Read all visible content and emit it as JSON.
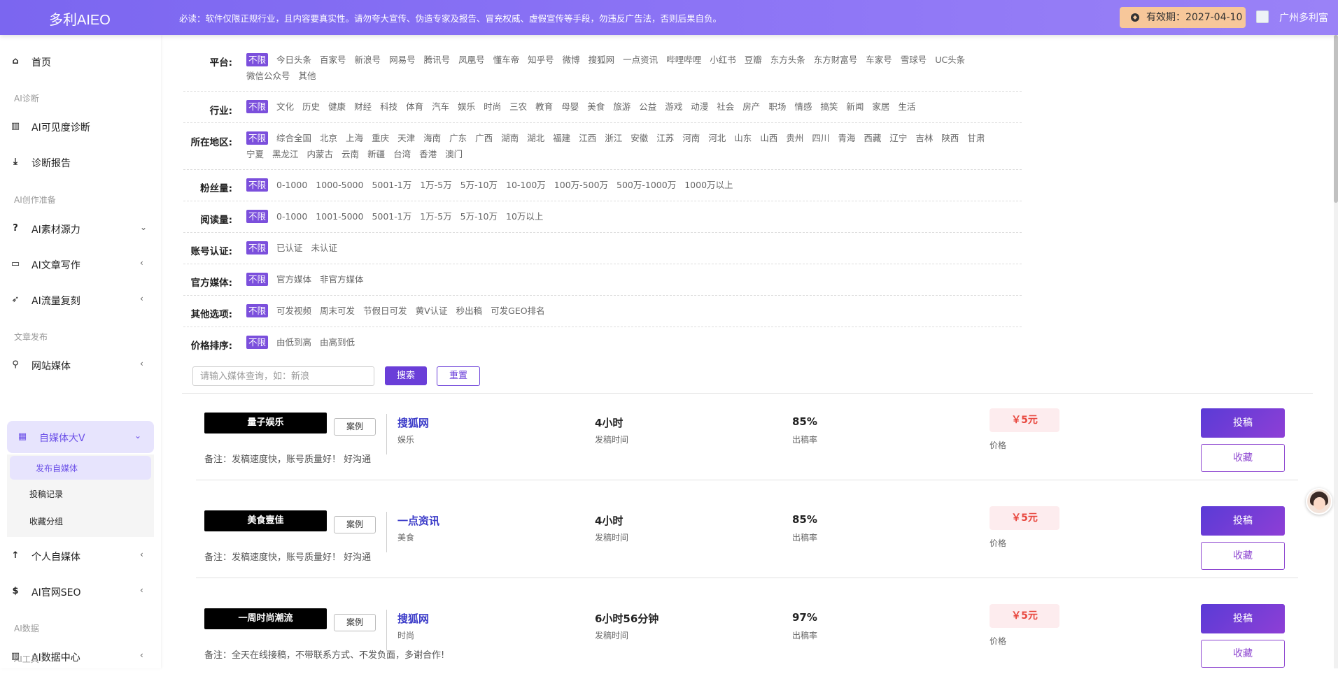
{
  "header": {
    "logo": "多利AIEO",
    "notice": "必读：软件仅限正规行业，且内容要真实性。请勿夸大宣传、伪造专家及报告、冒充权威、虚假宣传等手段，勿违反广告法，否则后果自负。",
    "validity": "有效期：2027-04-10",
    "company": "广州多利富"
  },
  "sidebar": {
    "home": "首页",
    "sec_diag": "AI诊断",
    "diag_visibility": "AI可见度诊断",
    "diag_report": "诊断报告",
    "sec_prep": "AI创作准备",
    "material": "AI素材源力",
    "writing": "AI文章写作",
    "traffic": "AI流量复刻",
    "sec_publish": "文章发布",
    "web_media": "网站媒体",
    "selfmedia": "自媒体大V",
    "sub_publish": "发布自媒体",
    "sub_records": "投稿记录",
    "sub_fav": "收藏分组",
    "personal": "个人自媒体",
    "seo": "AI官网SEO",
    "sec_data": "AI数据",
    "data_center": "AI数据中心",
    "sec_tools": "AI工具"
  },
  "filters": [
    {
      "label": "平台:",
      "options": [
        "不限",
        "今日头条",
        "百家号",
        "新浪号",
        "网易号",
        "腾讯号",
        "凤凰号",
        "懂车帝",
        "知乎号",
        "微博",
        "搜狐网",
        "一点资讯",
        "哔哩哔哩",
        "小红书",
        "豆瓣",
        "东方头条",
        "东方财富号",
        "车家号",
        "雪球号",
        "UC头条",
        "微信公众号",
        "其他"
      ]
    },
    {
      "label": "行业:",
      "options": [
        "不限",
        "文化",
        "历史",
        "健康",
        "财经",
        "科技",
        "体育",
        "汽车",
        "娱乐",
        "时尚",
        "三农",
        "教育",
        "母婴",
        "美食",
        "旅游",
        "公益",
        "游戏",
        "动漫",
        "社会",
        "房产",
        "职场",
        "情感",
        "搞笑",
        "新闻",
        "家居",
        "生活"
      ]
    },
    {
      "label": "所在地区:",
      "options": [
        "不限",
        "综合全国",
        "北京",
        "上海",
        "重庆",
        "天津",
        "海南",
        "广东",
        "广西",
        "湖南",
        "湖北",
        "福建",
        "江西",
        "浙江",
        "安徽",
        "江苏",
        "河南",
        "河北",
        "山东",
        "山西",
        "贵州",
        "四川",
        "青海",
        "西藏",
        "辽宁",
        "吉林",
        "陕西",
        "甘肃",
        "宁夏",
        "黑龙江",
        "内蒙古",
        "云南",
        "新疆",
        "台湾",
        "香港",
        "澳门"
      ]
    },
    {
      "label": "粉丝量:",
      "options": [
        "不限",
        "0-1000",
        "1000-5000",
        "5001-1万",
        "1万-5万",
        "5万-10万",
        "10-100万",
        "100万-500万",
        "500万-1000万",
        "1000万以上"
      ]
    },
    {
      "label": "阅读量:",
      "options": [
        "不限",
        "0-1000",
        "1001-5000",
        "5001-1万",
        "1万-5万",
        "5万-10万",
        "10万以上"
      ]
    },
    {
      "label": "账号认证:",
      "options": [
        "不限",
        "已认证",
        "未认证"
      ]
    },
    {
      "label": "官方媒体:",
      "options": [
        "不限",
        "官方媒体",
        "非官方媒体"
      ]
    },
    {
      "label": "其他选项:",
      "options": [
        "不限",
        "可发视频",
        "周末可发",
        "节假日可发",
        "黄V认证",
        "秒出稿",
        "可发GEO排名"
      ]
    },
    {
      "label": "价格排序:",
      "options": [
        "不限",
        "由低到高",
        "由高到低"
      ]
    }
  ],
  "search": {
    "placeholder": "请输入媒体查询，如：新浪",
    "search_btn": "搜索",
    "reset_btn": "重置"
  },
  "cards": [
    {
      "name": "量子娱乐",
      "case": "案例",
      "platform": "搜狐网",
      "industry": "娱乐",
      "time": "4小时",
      "time_label": "发稿时间",
      "rate": "85%",
      "rate_label": "出稿率",
      "price": "￥5元",
      "price_label": "价格",
      "submit": "投稿",
      "fav": "收藏",
      "note": "备注：发稿速度快，账号质量好！ 好沟通"
    },
    {
      "name": "美食壹佳",
      "case": "案例",
      "platform": "一点资讯",
      "industry": "美食",
      "time": "4小时",
      "time_label": "发稿时间",
      "rate": "85%",
      "rate_label": "出稿率",
      "price": "￥5元",
      "price_label": "价格",
      "submit": "投稿",
      "fav": "收藏",
      "note": "备注：发稿速度快，账号质量好！ 好沟通"
    },
    {
      "name": "一周时尚潮流",
      "case": "案例",
      "platform": "搜狐网",
      "industry": "时尚",
      "time": "6小时56分钟",
      "time_label": "发稿时间",
      "rate": "97%",
      "rate_label": "出稿率",
      "price": "￥5元",
      "price_label": "价格",
      "submit": "投稿",
      "fav": "收藏",
      "note": "备注：全天在线接稿，不带联系方式、不发负面，多谢合作!"
    }
  ]
}
